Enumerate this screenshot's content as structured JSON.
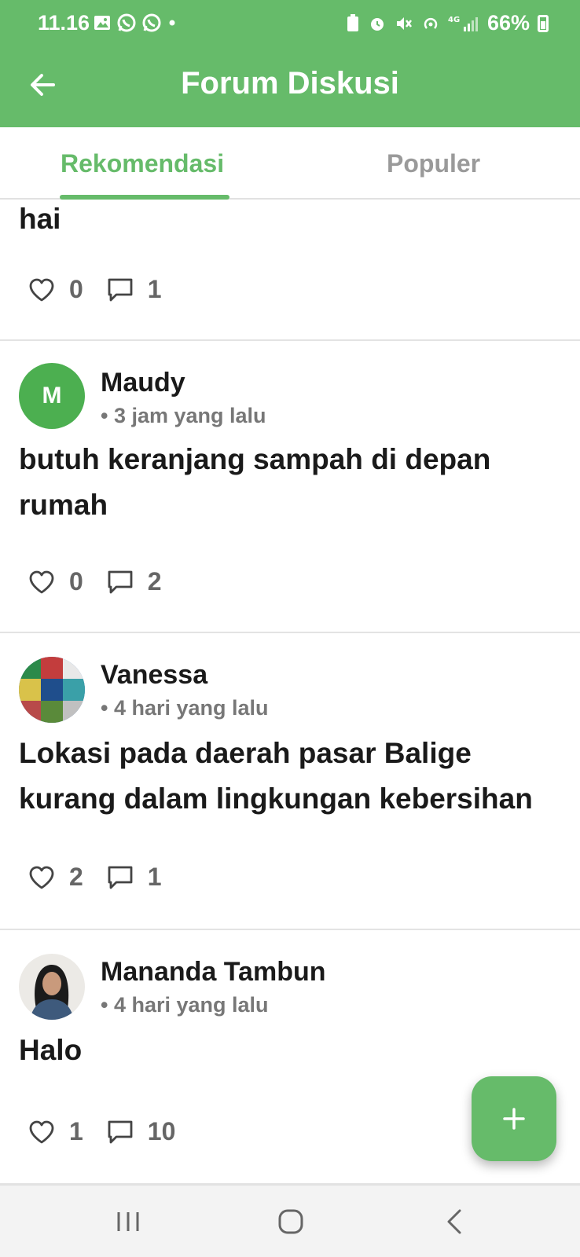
{
  "status_bar": {
    "time": "11.16",
    "battery": "66%",
    "network": "4G"
  },
  "header": {
    "title": "Forum Diskusi",
    "back_icon": "arrow-left-icon"
  },
  "tabs": [
    {
      "label": "Rekomendasi",
      "active": true
    },
    {
      "label": "Populer",
      "active": false
    }
  ],
  "posts": [
    {
      "author": "",
      "time": "",
      "text": "hai",
      "likes": "0",
      "comments": "1",
      "avatar": ""
    },
    {
      "author": "Maudy",
      "time": "• 3 jam yang lalu",
      "text": "butuh keranjang sampah di depan rumah",
      "likes": "0",
      "comments": "2",
      "avatar": "M"
    },
    {
      "author": "Vanessa",
      "time": "• 4 hari yang lalu",
      "text": "Lokasi pada daerah pasar Balige kurang dalam lingkungan kebersihan",
      "likes": "2",
      "comments": "1",
      "avatar": "photo"
    },
    {
      "author": "Mananda Tambun",
      "time": "• 4 hari yang lalu",
      "text": "Halo",
      "likes": "1",
      "comments": "10",
      "avatar": "photo"
    }
  ],
  "fab": {
    "icon": "plus-icon"
  },
  "colors": {
    "primary": "#66bb6a",
    "avatar_bg": "#4caf50",
    "muted_text": "#777777"
  }
}
